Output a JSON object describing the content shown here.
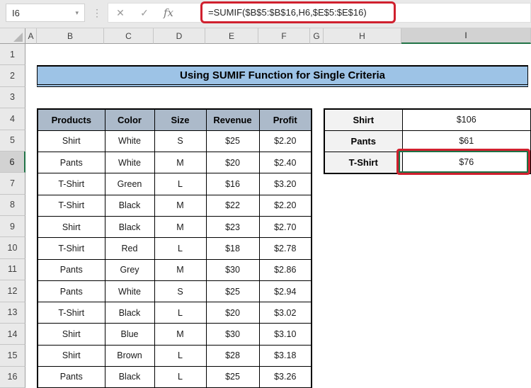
{
  "formula_bar": {
    "cell_reference": "I6",
    "formula": "=SUMIF($B$5:$B$16,H6,$E$5:$E$16)",
    "cancel_icon": "✕",
    "enter_icon": "✓",
    "fx_label": "fx",
    "dropdown_icon": "▾",
    "more_icon": "⋮"
  },
  "grid": {
    "column_headers": [
      "A",
      "B",
      "C",
      "D",
      "E",
      "F",
      "G",
      "H",
      "I"
    ],
    "row_headers": [
      "1",
      "2",
      "3",
      "4",
      "5",
      "6",
      "7",
      "8",
      "9",
      "10",
      "11",
      "12",
      "13",
      "14",
      "15",
      "16"
    ],
    "selected_column": "I",
    "selected_row": "6",
    "selected_cell": "I6"
  },
  "title_banner": {
    "text": "Using SUMIF Function for Single Criteria"
  },
  "data_table": {
    "headers": [
      "Products",
      "Color",
      "Size",
      "Revenue",
      "Profit"
    ],
    "rows": [
      {
        "product": "Shirt",
        "color": "White",
        "size": "S",
        "revenue": "$25",
        "profit": "$2.20"
      },
      {
        "product": "Pants",
        "color": "White",
        "size": "M",
        "revenue": "$20",
        "profit": "$2.40"
      },
      {
        "product": "T-Shirt",
        "color": "Green",
        "size": "L",
        "revenue": "$16",
        "profit": "$3.20"
      },
      {
        "product": "T-Shirt",
        "color": "Black",
        "size": "M",
        "revenue": "$22",
        "profit": "$2.20"
      },
      {
        "product": "Shirt",
        "color": "Black",
        "size": "M",
        "revenue": "$23",
        "profit": "$2.70"
      },
      {
        "product": "T-Shirt",
        "color": "Red",
        "size": "L",
        "revenue": "$18",
        "profit": "$2.78"
      },
      {
        "product": "Pants",
        "color": "Grey",
        "size": "M",
        "revenue": "$30",
        "profit": "$2.86"
      },
      {
        "product": "Pants",
        "color": "White",
        "size": "S",
        "revenue": "$25",
        "profit": "$2.94"
      },
      {
        "product": "T-Shirt",
        "color": "Black",
        "size": "L",
        "revenue": "$20",
        "profit": "$3.02"
      },
      {
        "product": "Shirt",
        "color": "Blue",
        "size": "M",
        "revenue": "$30",
        "profit": "$3.10"
      },
      {
        "product": "Shirt",
        "color": "Brown",
        "size": "L",
        "revenue": "$28",
        "profit": "$3.18"
      },
      {
        "product": "Pants",
        "color": "Black",
        "size": "L",
        "revenue": "$25",
        "profit": "$3.26"
      }
    ]
  },
  "summary_table": {
    "rows": [
      {
        "label": "Shirt",
        "value": "$106"
      },
      {
        "label": "Pants",
        "value": "$61"
      },
      {
        "label": "T-Shirt",
        "value": "$76"
      }
    ]
  },
  "colors": {
    "annotation_red": "#d0202e",
    "selection_green": "#217346",
    "banner_blue": "#9dc3e6",
    "table_header_bg": "#acbaca",
    "criteria_label_bg": "#f2f2f2"
  }
}
